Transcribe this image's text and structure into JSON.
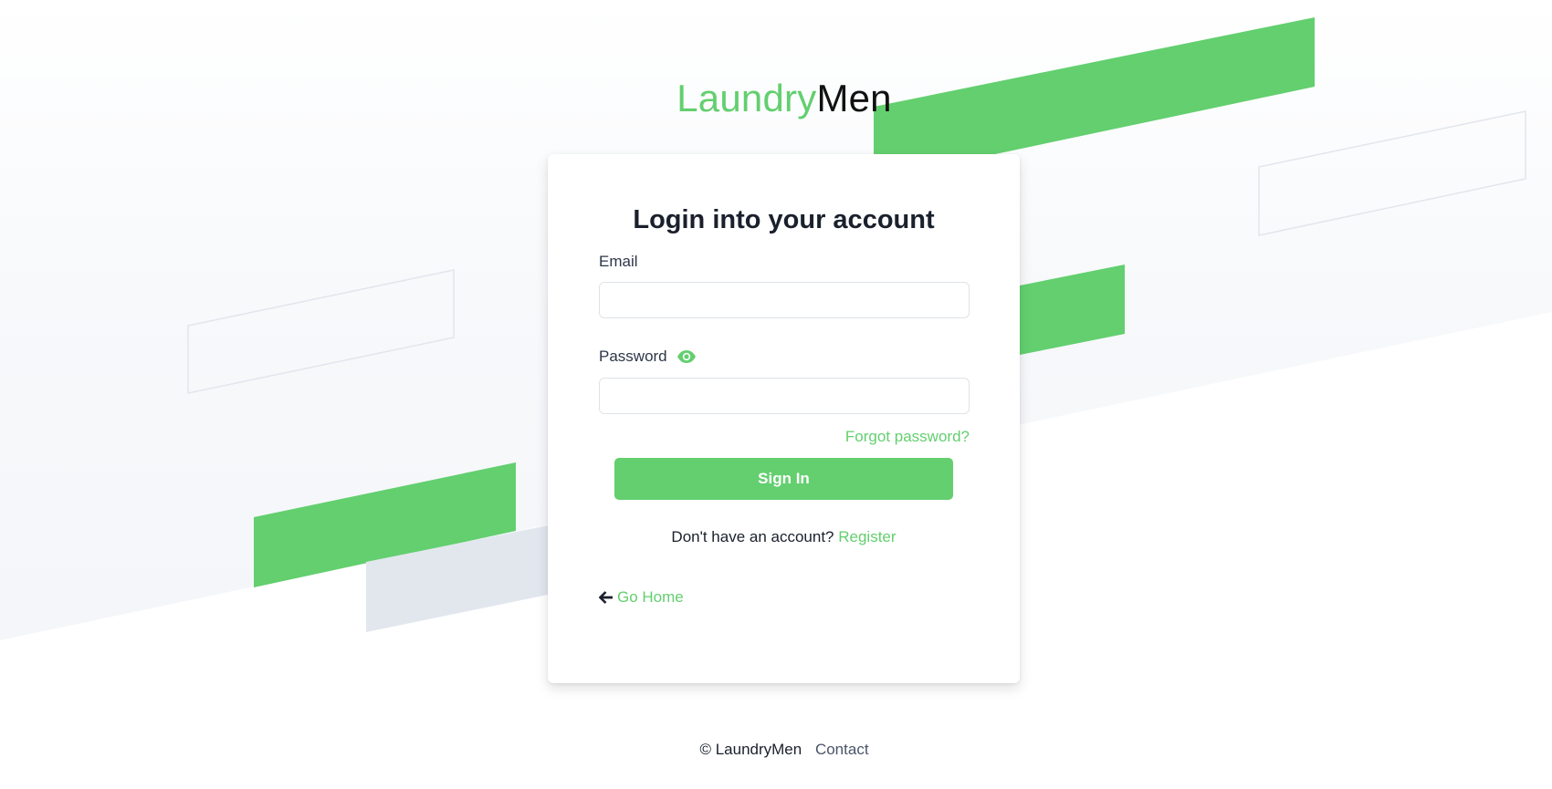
{
  "brand": {
    "part_a": "Laundry",
    "part_b": "Men"
  },
  "login_card": {
    "title": "Login into your account",
    "email_label": "Email",
    "email_value": "",
    "password_label": "Password",
    "password_value": "",
    "forgot_password": "Forgot password?",
    "sign_in_label": "Sign In",
    "register_prompt": "Don't have an account?",
    "register_link": "Register",
    "go_home": "Go Home"
  },
  "footer": {
    "copyright": "© LaundryMen",
    "contact": "Contact"
  },
  "icons": {
    "password_toggle": "eye-icon",
    "go_home": "arrow-left-icon"
  },
  "colors": {
    "accent": "#63cf6f",
    "background_band": "#f7f9fb",
    "grey_shape": "#e2e7ee",
    "text_dark": "#1a202c",
    "text_muted": "#4a5568"
  }
}
